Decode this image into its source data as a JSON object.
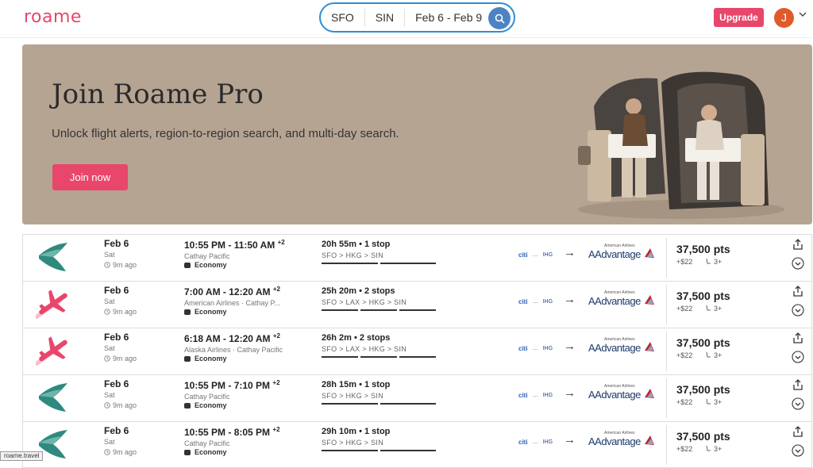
{
  "brand": {
    "logo_text": "roame",
    "accent": "#e8466a"
  },
  "search": {
    "origin": "SFO",
    "destination": "SIN",
    "dates": "Feb 6 - Feb 9"
  },
  "header": {
    "upgrade_label": "Upgrade",
    "avatar_initial": "J"
  },
  "banner": {
    "title": "Join Roame Pro",
    "subtitle": "Unlock flight alerts, region-to-region search, and multi-day search.",
    "cta_label": "Join now"
  },
  "results": [
    {
      "airline_icon": "cathay-logo",
      "date": "Feb 6",
      "dow": "Sat",
      "ago": "9m ago",
      "times": "10:55 PM - 11:50 AM",
      "day_offset": "+2",
      "carrier": "Cathay Pacific",
      "cabin": "Economy",
      "duration": "20h 55m • 1 stop",
      "route": "SFO  >  HKG  >  SIN",
      "segments": 2,
      "programs": [
        "citi",
        "…",
        "IHG"
      ],
      "program_partner": "AAdvantage",
      "program_partner_small": "American Airlines",
      "points": "37,500 pts",
      "fee": "+$22",
      "seats": "3+"
    },
    {
      "airline_icon": "plane-icon",
      "date": "Feb 6",
      "dow": "Sat",
      "ago": "9m ago",
      "times": "7:00 AM - 12:20 AM",
      "day_offset": "+2",
      "carrier": "American Airlines · Cathay P...",
      "cabin": "Economy",
      "duration": "25h 20m • 2 stops",
      "route": "SFO  >  LAX  >  HKG  >  SIN",
      "segments": 3,
      "programs": [
        "citi",
        "…",
        "IHG"
      ],
      "program_partner": "AAdvantage",
      "program_partner_small": "American Airlines",
      "points": "37,500 pts",
      "fee": "+$22",
      "seats": "3+"
    },
    {
      "airline_icon": "plane-icon",
      "date": "Feb 6",
      "dow": "Sat",
      "ago": "9m ago",
      "times": "6:18 AM - 12:20 AM",
      "day_offset": "+2",
      "carrier": "Alaska Airlines · Cathay Pacific",
      "cabin": "Economy",
      "duration": "26h 2m • 2 stops",
      "route": "SFO  >  LAX  >  HKG  >  SIN",
      "segments": 3,
      "programs": [
        "citi",
        "…",
        "IHG"
      ],
      "program_partner": "AAdvantage",
      "program_partner_small": "American Airlines",
      "points": "37,500 pts",
      "fee": "+$22",
      "seats": "3+"
    },
    {
      "airline_icon": "cathay-logo",
      "date": "Feb 6",
      "dow": "Sat",
      "ago": "9m ago",
      "times": "10:55 PM - 7:10 PM",
      "day_offset": "+2",
      "carrier": "Cathay Pacific",
      "cabin": "Economy",
      "duration": "28h 15m • 1 stop",
      "route": "SFO  >  HKG  >  SIN",
      "segments": 2,
      "programs": [
        "citi",
        "…",
        "IHG"
      ],
      "program_partner": "AAdvantage",
      "program_partner_small": "American Airlines",
      "points": "37,500 pts",
      "fee": "+$22",
      "seats": "3+"
    },
    {
      "airline_icon": "cathay-logo",
      "date": "Feb 6",
      "dow": "Sat",
      "ago": "9m ago",
      "times": "10:55 PM - 8:05 PM",
      "day_offset": "+2",
      "carrier": "Cathay Pacific",
      "cabin": "Economy",
      "duration": "29h 10m • 1 stop",
      "route": "SFO  >  HKG  >  SIN",
      "segments": 2,
      "programs": [
        "citi",
        "…",
        "IHG"
      ],
      "program_partner": "AAdvantage",
      "program_partner_small": "American Airlines",
      "points": "37,500 pts",
      "fee": "+$22",
      "seats": "3+"
    }
  ],
  "status_tooltip": "roame.travel"
}
